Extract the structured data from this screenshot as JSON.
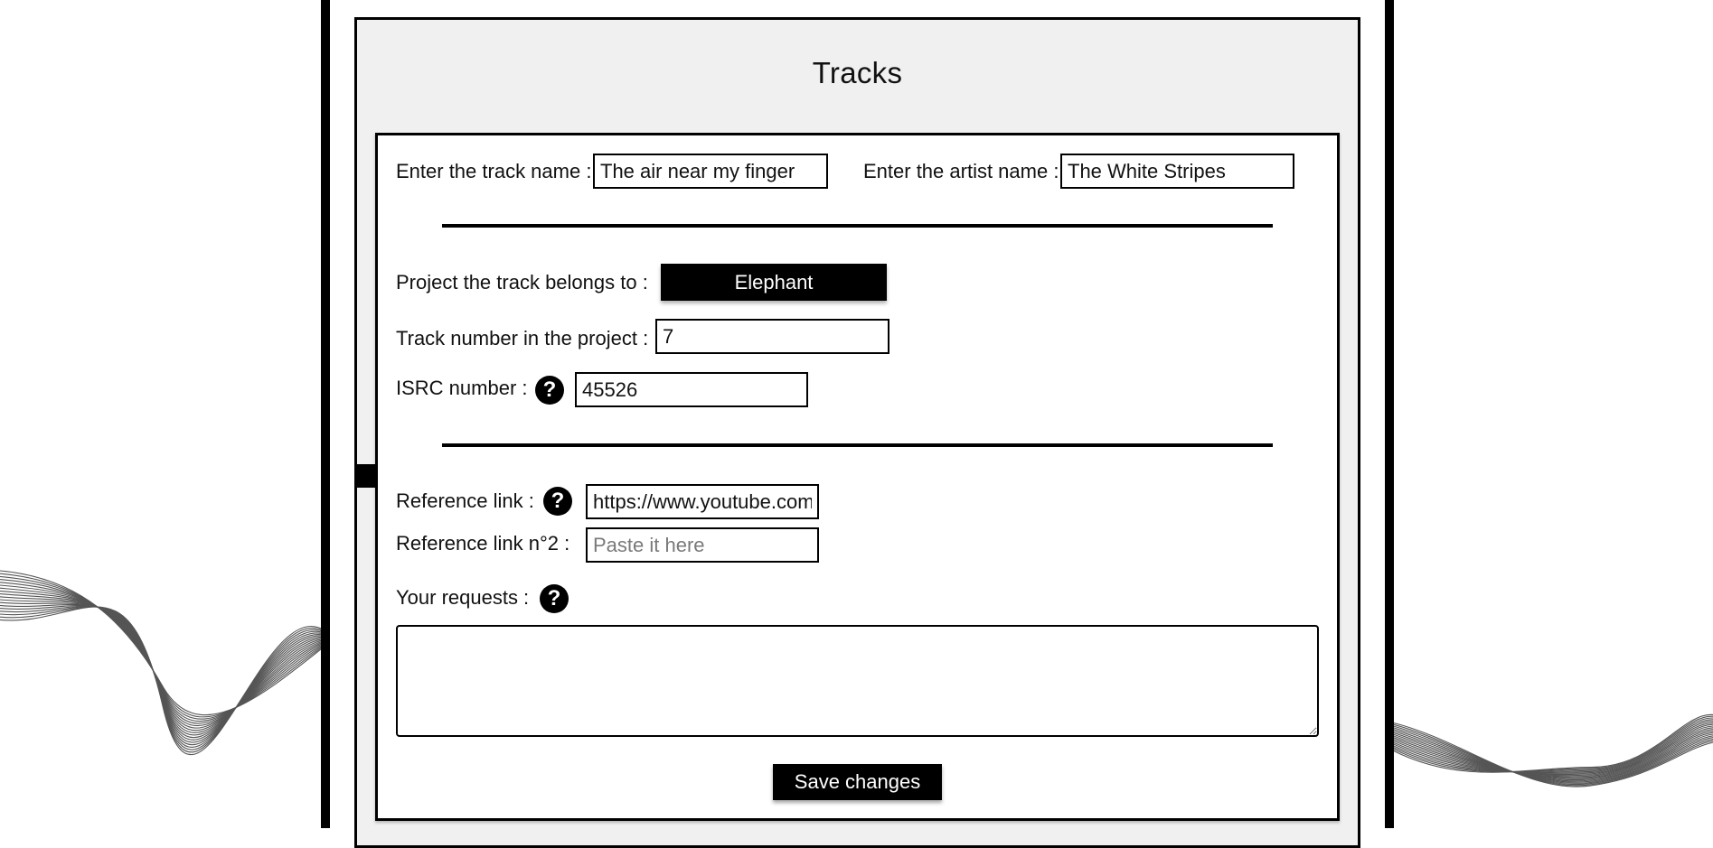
{
  "panel": {
    "title": "Tracks"
  },
  "track_name": {
    "label": "Enter the track name :",
    "value": "The air near my finger"
  },
  "artist_name": {
    "label": "Enter the artist name :",
    "value": "The White Stripes"
  },
  "project": {
    "label": "Project the track belongs to :",
    "selected": "Elephant"
  },
  "track_number": {
    "label": "Track number in the project :",
    "value": "7"
  },
  "isrc": {
    "label": "ISRC number :",
    "value": "45526",
    "help_icon": "question-mark"
  },
  "reference_link": {
    "label": "Reference link :",
    "value": "https://www.youtube.com",
    "help_icon": "question-mark"
  },
  "reference_link_2": {
    "label": "Reference link n°2 :",
    "placeholder": "Paste it here"
  },
  "requests": {
    "label": "Your requests :",
    "value": "",
    "help_icon": "question-mark"
  },
  "help_glyph": "?",
  "save_button": {
    "label": "Save changes"
  },
  "colors": {
    "accent": "#000000",
    "panel_bg": "#f0f0f0",
    "card_bg": "#ffffff"
  }
}
